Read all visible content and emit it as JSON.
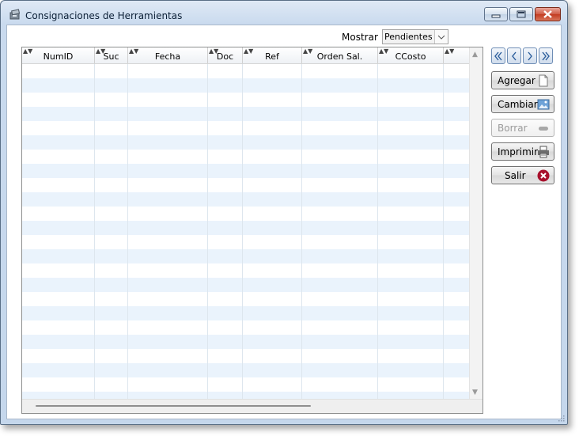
{
  "window": {
    "title": "Consignaciones de Herramientas",
    "controls": [
      "minimize",
      "maximize",
      "close"
    ]
  },
  "filter": {
    "label": "Mostrar",
    "selected": "Pendientes"
  },
  "grid": {
    "columns": [
      "NumID",
      "Suc",
      "Fecha",
      "Doc",
      "Ref",
      "Orden Sal.",
      "CCosto",
      ""
    ],
    "rows": []
  },
  "navigation": {
    "icons": [
      "first-icon",
      "prev-icon",
      "next-icon",
      "last-icon"
    ]
  },
  "buttons": {
    "agregar": "Agregar",
    "cambiar": "Cambiar",
    "borrar": "Borrar",
    "imprimir": "Imprimir",
    "salir": "Salir"
  },
  "colors": {
    "row_alt": "#eaf3fc",
    "accent": "#6e8db5",
    "close_icon": "#a8102c"
  }
}
